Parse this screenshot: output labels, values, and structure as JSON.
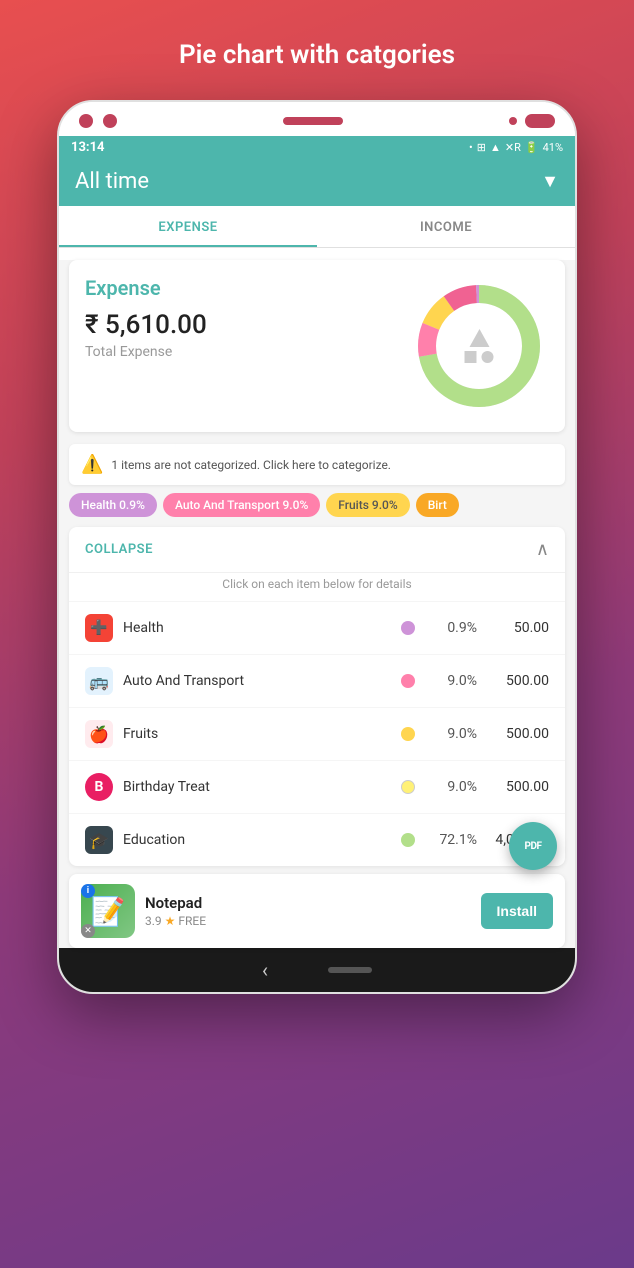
{
  "page": {
    "title": "Pie chart with catgories",
    "background_gradient_start": "#e84f4f",
    "background_gradient_end": "#6b3a8a"
  },
  "status_bar": {
    "time": "13:14",
    "battery": "41%",
    "signal_icons": "• ⊞ ▲ ✕R 🔋"
  },
  "header": {
    "title": "All time",
    "dropdown_icon": "▼"
  },
  "tabs": [
    {
      "label": "EXPENSE",
      "active": true
    },
    {
      "label": "INCOME",
      "active": false
    }
  ],
  "expense_section": {
    "label": "Expense",
    "amount": "₹ 5,610.00",
    "subtitle": "Total Expense"
  },
  "donut_chart": {
    "segments": [
      {
        "color": "#b2df8a",
        "pct": 72.1,
        "label": "Education"
      },
      {
        "color": "#ff80ab",
        "pct": 9.0,
        "label": "Auto And Transport"
      },
      {
        "color": "#ffd54f",
        "pct": 9.0,
        "label": "Fruits"
      },
      {
        "color": "#f06292",
        "pct": 9.0,
        "label": "Birthday Treat"
      },
      {
        "color": "#ce93d8",
        "pct": 0.9,
        "label": "Health"
      }
    ]
  },
  "warning": {
    "icon": "⚠️",
    "text": "1 items are not categorized. Click here to categorize."
  },
  "category_tags": [
    {
      "label": "Health 0.9%",
      "color": "#ce93d8"
    },
    {
      "label": "Auto And Transport 9.0%",
      "color": "#ff80ab"
    },
    {
      "label": "Fruits 9.0%",
      "color": "#ffd54f"
    },
    {
      "label": "Birt",
      "color": "#f9a825"
    }
  ],
  "collapse": {
    "label": "COLLAPSE",
    "hint": "Click on each item below for details",
    "icon": "∧"
  },
  "list_items": [
    {
      "name": "Health",
      "icon": "➕",
      "icon_bg": "#f44336",
      "dot_color": "#ce93d8",
      "pct": "0.9%",
      "amount": "50.00"
    },
    {
      "name": "Auto And Transport",
      "icon": "🚌",
      "icon_bg": "#29b6f6",
      "dot_color": "#ff80ab",
      "pct": "9.0%",
      "amount": "500.00"
    },
    {
      "name": "Fruits",
      "icon": "🍎",
      "icon_bg": "#ef5350",
      "dot_color": "#ffd54f",
      "pct": "9.0%",
      "amount": "500.00"
    },
    {
      "name": "Birthday Treat",
      "icon": "B",
      "icon_bg": "#e91e63",
      "dot_color": "#fff176",
      "pct": "9.0%",
      "amount": "500.00"
    },
    {
      "name": "Education",
      "icon": "🎓",
      "icon_bg": "#37474f",
      "dot_color": "#b2df8a",
      "pct": "72.1%",
      "amount": "4,000.00"
    }
  ],
  "fab": {
    "icon": "PDF",
    "color": "#4db6ac"
  },
  "ad": {
    "app_name": "Notepad",
    "rating": "3.9",
    "star": "★",
    "free_label": "FREE",
    "install_label": "Install"
  },
  "bottom_nav": {
    "back_icon": "‹"
  }
}
